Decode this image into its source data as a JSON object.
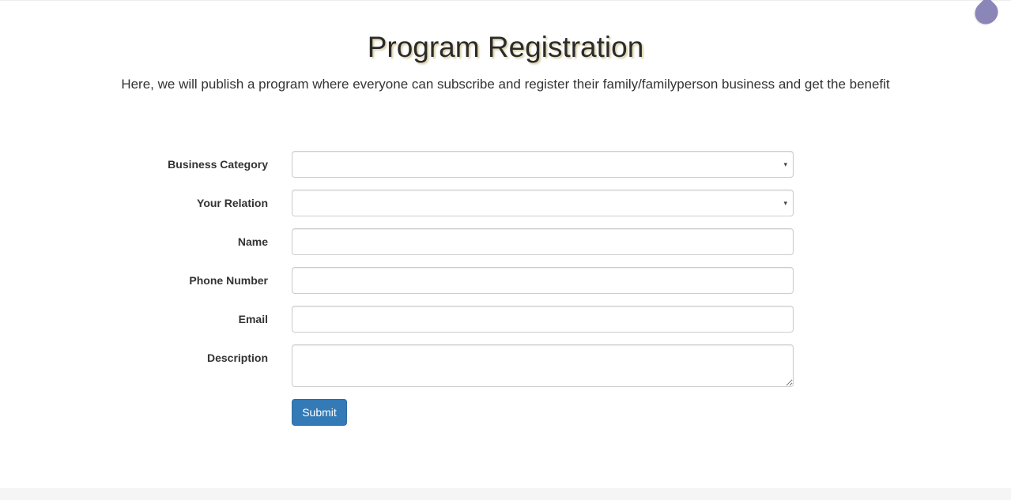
{
  "header": {
    "title": "Program Registration",
    "subtitle": "Here, we will publish a program where everyone can subscribe and register their family/familyperson business and get the benefit"
  },
  "form": {
    "business_category": {
      "label": "Business Category",
      "value": ""
    },
    "relation": {
      "label": "Your Relation",
      "value": ""
    },
    "name": {
      "label": "Name",
      "value": ""
    },
    "phone": {
      "label": "Phone Number",
      "value": ""
    },
    "email": {
      "label": "Email",
      "value": ""
    },
    "description": {
      "label": "Description",
      "value": ""
    },
    "submit_label": "Submit"
  },
  "icons": {
    "select_caret": "▾",
    "floating_button": "droplet-icon"
  },
  "colors": {
    "primary": "#337ab7",
    "floating": "#8a86b8",
    "title_shadow": "#d9cfa3"
  }
}
